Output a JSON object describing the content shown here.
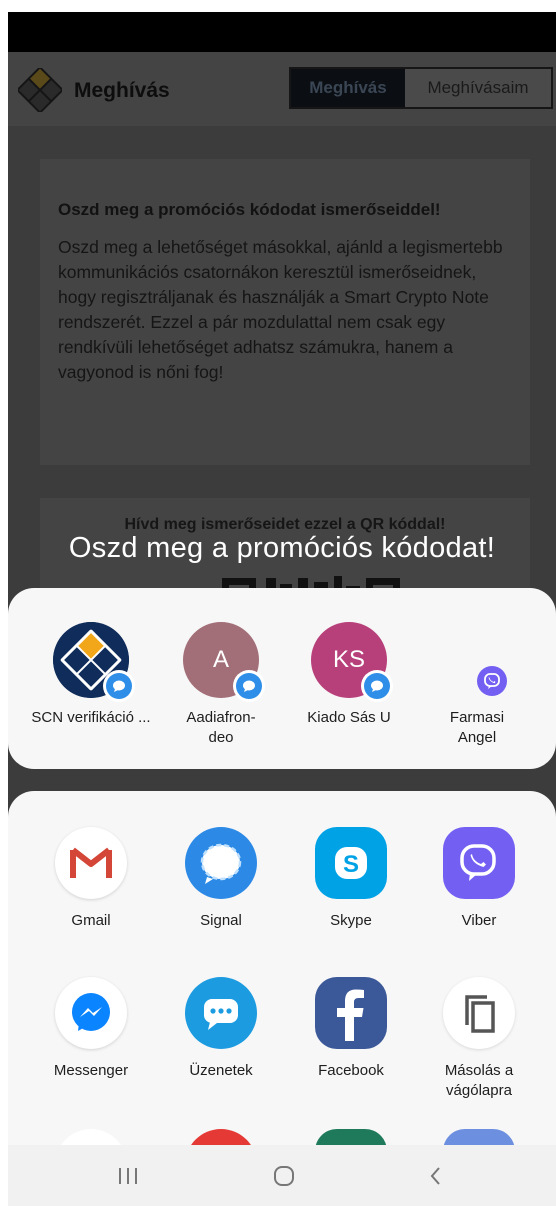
{
  "header": {
    "title": "Meghívás",
    "tabs": [
      {
        "label": "Meghívás",
        "active": true
      },
      {
        "label": "Meghívásaim",
        "active": false
      }
    ]
  },
  "promo_card": {
    "heading": "Oszd meg a promóciós kódodat ismerőseiddel!",
    "body": "Oszd meg a lehetőséget másokkal, ajánld a legismertebb kommunikációs csatornákon keresztül ismerőseidnek, hogy regisztráljanak és használják a Smart Crypto Note rendszerét. Ezzel a pár mozdulattal nem csak egy rendkívüli lehetőséget adhatsz számukra, hanem a vagyonod is nőni fog!"
  },
  "qr_card": {
    "heading": "Hívd meg ismerőseidet ezzel a QR kóddal!"
  },
  "share_sheet": {
    "title": "Oszd meg a promóciós kódodat!",
    "direct_targets": [
      {
        "label": "SCN verifikáció ...",
        "initials": "",
        "icon": "scn-logo",
        "badge": "messages-badge"
      },
      {
        "label": "Aadiafron-deo",
        "initials": "A",
        "color": "#a26e78",
        "badge": "messages-badge"
      },
      {
        "label": "Kiado Sás U",
        "initials": "KS",
        "color": "#b7407a",
        "badge": "messages-badge"
      },
      {
        "label": "Farmasi Angel",
        "initials": "",
        "icon": "viber-icon",
        "badge": ""
      }
    ],
    "apps": [
      {
        "label": "Gmail",
        "icon": "gmail-icon"
      },
      {
        "label": "Signal",
        "icon": "signal-icon"
      },
      {
        "label": "Skype",
        "icon": "skype-icon"
      },
      {
        "label": "Viber",
        "icon": "viber-icon"
      },
      {
        "label": "Messenger",
        "icon": "messenger-icon"
      },
      {
        "label": "Üzenetek",
        "icon": "messages-icon"
      },
      {
        "label": "Facebook",
        "icon": "facebook-icon"
      },
      {
        "label": "Másolás a vágólapra",
        "icon": "copy-icon"
      }
    ],
    "more_apps_icons": [
      "google-drive-icon",
      "email-icon",
      "green-app-icon",
      "blue-app-icon"
    ]
  },
  "navigation": {
    "buttons": [
      "recent-apps-icon",
      "home-icon",
      "back-icon"
    ]
  },
  "colors": {
    "scrim": "#3c3c3c",
    "panel": "#f7f7f7",
    "accent_blue": "#2f8ee8",
    "viber_purple": "#7360f2",
    "skype_blue": "#00a2e6",
    "facebook_blue": "#3b5998",
    "gmail_red": "#d44638"
  }
}
